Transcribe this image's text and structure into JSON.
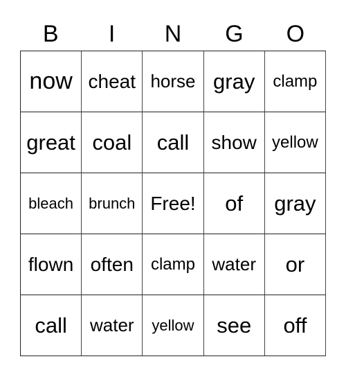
{
  "header": {
    "letters": [
      "B",
      "I",
      "N",
      "G",
      "O"
    ]
  },
  "card": {
    "rows": [
      [
        "now",
        "cheat",
        "horse",
        "gray",
        "clamp"
      ],
      [
        "great",
        "coal",
        "call",
        "show",
        "yellow"
      ],
      [
        "bleach",
        "brunch",
        "Free!",
        "of",
        "gray"
      ],
      [
        "flown",
        "often",
        "clamp",
        "water",
        "or"
      ],
      [
        "call",
        "water",
        "yellow",
        "see",
        "off"
      ]
    ]
  }
}
